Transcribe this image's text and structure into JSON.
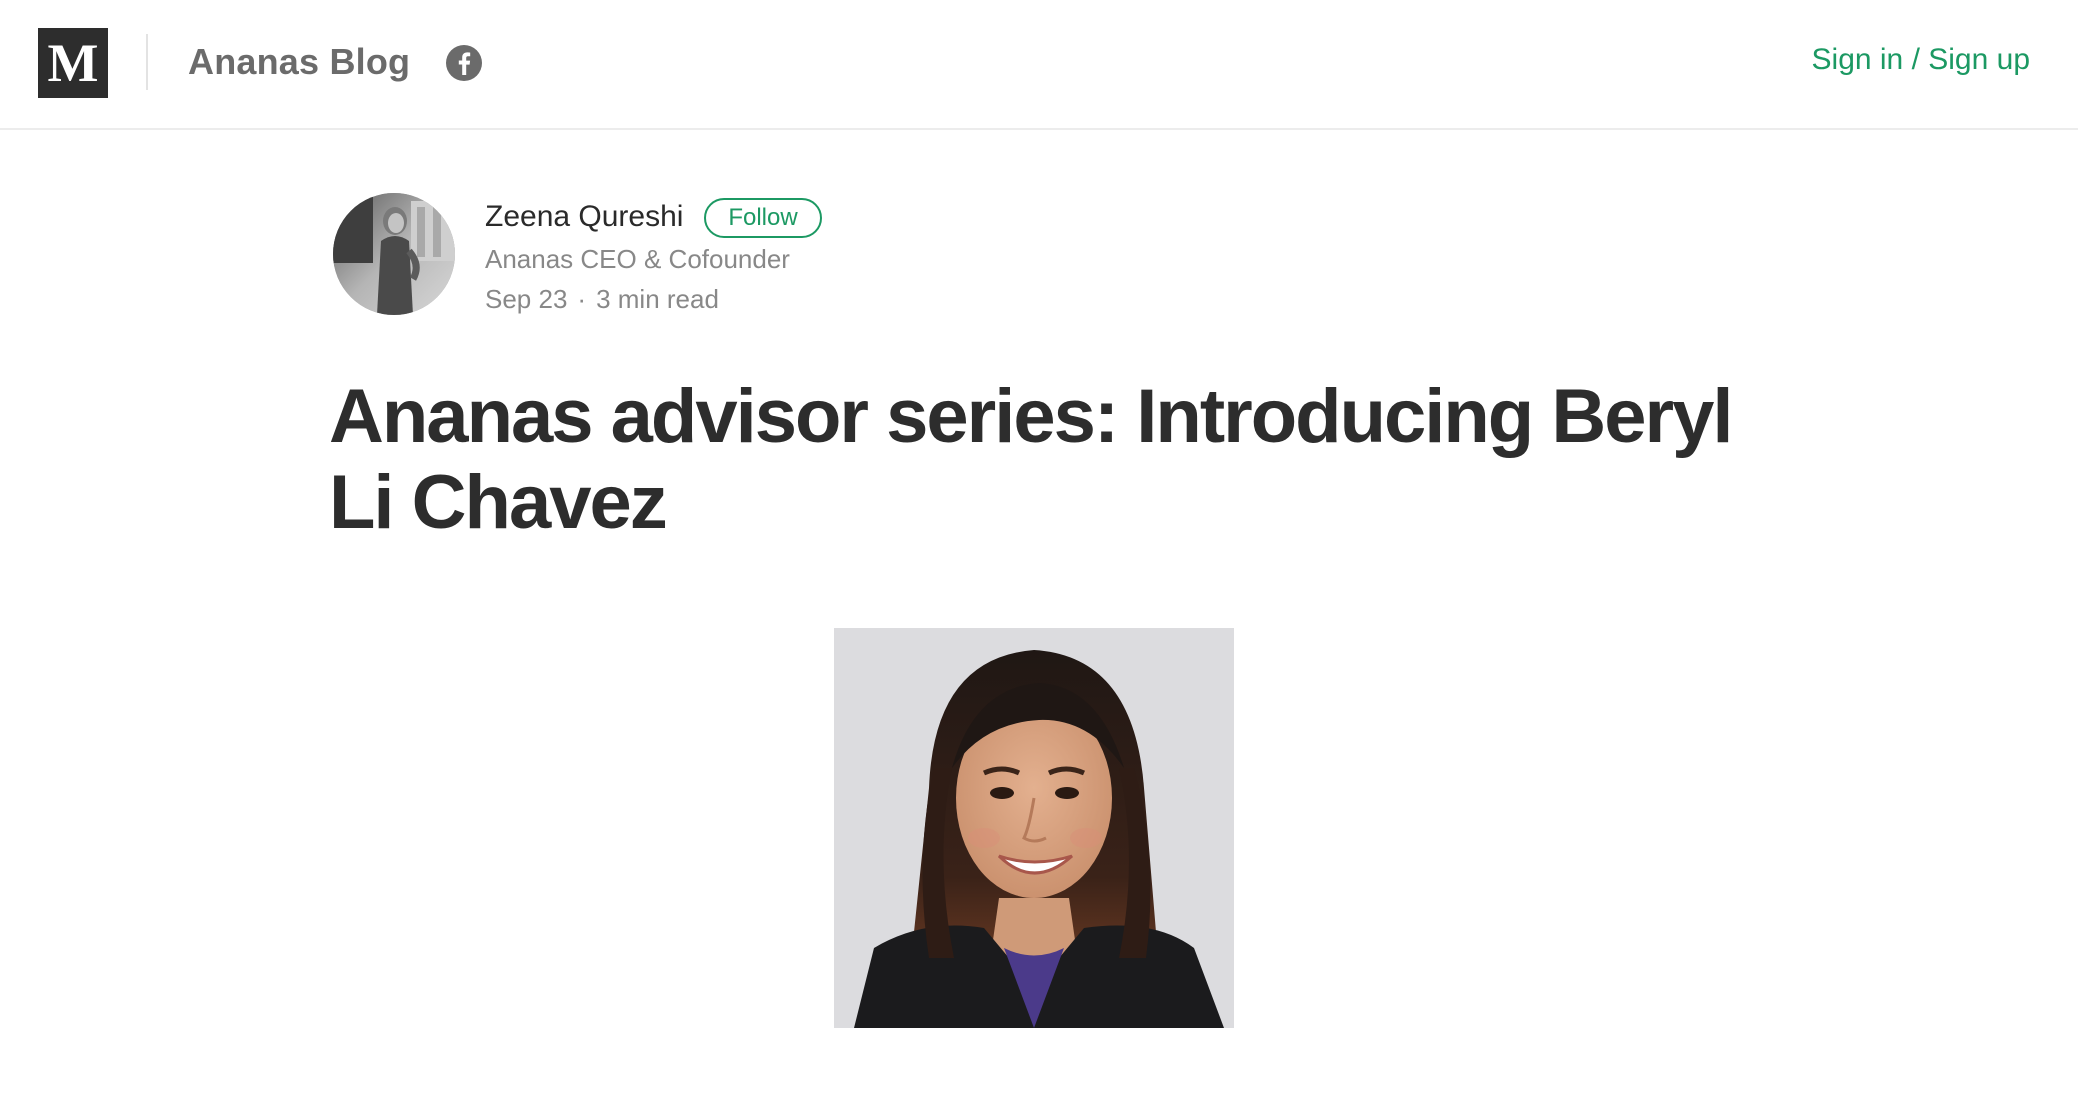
{
  "header": {
    "logo_letter": "M",
    "blog_name": "Ananas Blog",
    "social_icon": "facebook-icon",
    "signin_label": "Sign in / Sign up"
  },
  "author": {
    "name": "Zeena Qureshi",
    "follow_label": "Follow",
    "bio": "Ananas CEO & Cofounder",
    "date": "Sep 23",
    "separator": "·",
    "read_time": "3 min read"
  },
  "post": {
    "title": "Ananas advisor series: Introducing Beryl Li Chavez"
  },
  "colors": {
    "accent": "#1c9963",
    "logo_bg": "#2d2d2d",
    "title_text": "#2d2d2d",
    "muted_text": "#888888"
  }
}
